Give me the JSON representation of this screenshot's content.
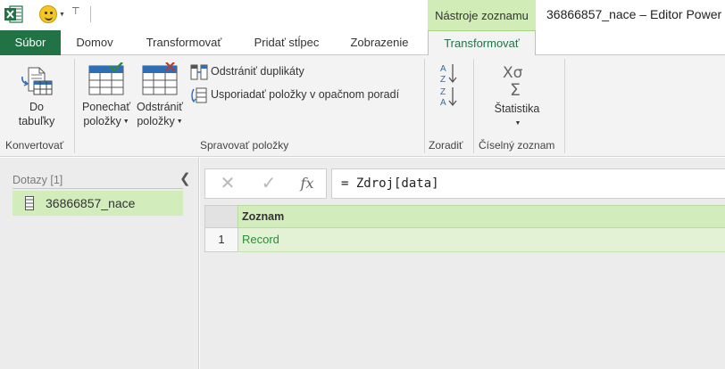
{
  "window": {
    "title": "36866857_nace – Editor Power",
    "context_tab_header": "Nástroje zoznamu"
  },
  "tabs": [
    {
      "label": "Súbor"
    },
    {
      "label": "Domov"
    },
    {
      "label": "Transformovať"
    },
    {
      "label": "Pridať stĺpec"
    },
    {
      "label": "Zobrazenie"
    },
    {
      "label": "Transformovať"
    }
  ],
  "ribbon": {
    "convert": {
      "to_table": {
        "line1": "Do",
        "line2": "tabuľky"
      },
      "group_label": "Konvertovať"
    },
    "manage": {
      "keep_items": {
        "line1": "Ponechať",
        "line2": "položky"
      },
      "remove_items": {
        "line1": "Odstrániť",
        "line2": "položky"
      },
      "remove_duplicates": "Odstrániť duplikáty",
      "reverse_items": "Usporiadať položky v opačnom poradí",
      "group_label": "Spravovať položky"
    },
    "sort": {
      "group_label": "Zoradiť"
    },
    "numeric": {
      "statistics": "Štatistika",
      "group_label": "Číselný zoznam"
    }
  },
  "queries": {
    "header": "Dotazy [1]",
    "items": [
      {
        "label": "36866857_nace"
      }
    ]
  },
  "formula_bar": {
    "formula": "= Zdroj[data]"
  },
  "grid": {
    "column": "Zoznam",
    "rows": [
      {
        "num": "1",
        "value": "Record"
      }
    ]
  }
}
